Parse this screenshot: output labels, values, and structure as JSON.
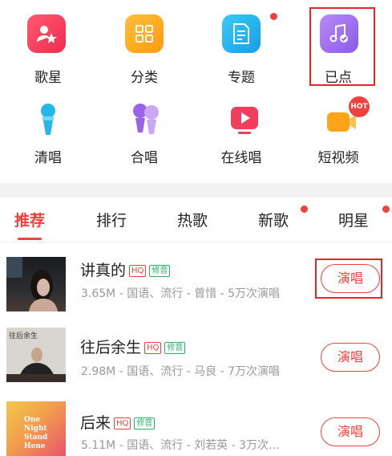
{
  "categories": [
    {
      "label": "歌星",
      "icon": "singer-star-icon",
      "color": "#f23d5c"
    },
    {
      "label": "分类",
      "icon": "category-grid-icon",
      "color": "#ffa31a"
    },
    {
      "label": "专题",
      "icon": "topic-document-icon",
      "color": "#1fb4f2"
    },
    {
      "label": "已点",
      "icon": "ordered-music-icon",
      "color": "#9b6df0"
    },
    {
      "label": "清唱",
      "icon": "microphone-icon",
      "color": "#25b7e8"
    },
    {
      "label": "合唱",
      "icon": "duet-microphones-icon",
      "color": "#9a63e8"
    },
    {
      "label": "在线唱",
      "icon": "online-play-icon",
      "color": "#f23d5c"
    },
    {
      "label": "短视频",
      "icon": "short-video-icon",
      "color": "#ffa31a",
      "badge": "HOT"
    }
  ],
  "tabs": [
    {
      "label": "推荐",
      "active": true
    },
    {
      "label": "排行"
    },
    {
      "label": "热歌"
    },
    {
      "label": "新歌",
      "dot": true
    },
    {
      "label": "明星"
    }
  ],
  "songs": [
    {
      "title": "讲真的",
      "badges": [
        "HQ",
        "修音"
      ],
      "meta": "3.65M - 国语、流行 - 曾惜 - 5万次演唱",
      "button": "演唱"
    },
    {
      "title": "往后余生",
      "badges": [
        "HQ",
        "修音"
      ],
      "meta": "2.98M - 国语、流行 - 马良 - 7万次演唱",
      "button": "演唱",
      "cover_text": "往后余生"
    },
    {
      "title": "后来",
      "badges": [
        "HQ",
        "修音"
      ],
      "meta": "5.11M - 国语、流行 - 刘若英 - 3万次...",
      "button": "演唱",
      "cover_text": "One Night Stand Hene"
    }
  ],
  "colors": {
    "accent": "#f0413c",
    "hq": "#f0413c",
    "edit": "#27b36b"
  }
}
